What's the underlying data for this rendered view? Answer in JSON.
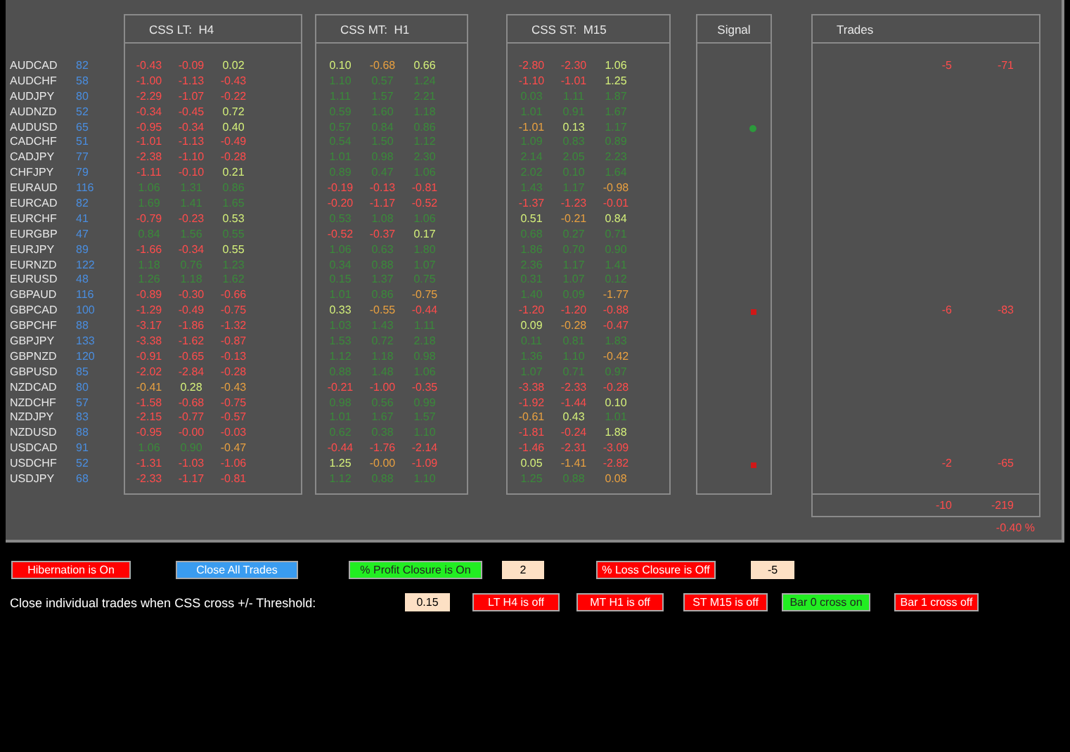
{
  "columns": [
    {
      "title": "CSS LT:  H4"
    },
    {
      "title": "CSS MT:  H1"
    },
    {
      "title": "CSS ST:  M15"
    }
  ],
  "signal_title": "Signal",
  "trades_title": "Trades",
  "rows": [
    {
      "pair": "AUDCAD",
      "count": "82",
      "lt": [
        {
          "text": "-0.43",
          "color": "#ff4c4c"
        },
        {
          "text": "-0.09",
          "color": "#ff4c4c"
        },
        {
          "text": "0.02",
          "color": "#d4f07a"
        }
      ],
      "mt": [
        {
          "text": "0.10",
          "color": "#d4f07a"
        },
        {
          "text": "-0.68",
          "color": "#e8a040"
        },
        {
          "text": "0.66",
          "color": "#d4f07a"
        }
      ],
      "st": [
        {
          "text": "-2.80",
          "color": "#ff4c4c"
        },
        {
          "text": "-2.30",
          "color": "#ff4c4c"
        },
        {
          "text": "1.06",
          "color": "#d4f07a"
        }
      ],
      "trades": [
        "-5",
        "-71"
      ]
    },
    {
      "pair": "AUDCHF",
      "count": "58",
      "lt": [
        {
          "text": "-1.00",
          "color": "#ff4c4c"
        },
        {
          "text": "-1.13",
          "color": "#ff4c4c"
        },
        {
          "text": "-0.43",
          "color": "#ff4c4c"
        }
      ],
      "mt": [
        {
          "text": "1.10",
          "color": "#3a8a3a"
        },
        {
          "text": "0.57",
          "color": "#3a8a3a"
        },
        {
          "text": "1.24",
          "color": "#3a8a3a"
        }
      ],
      "st": [
        {
          "text": "-1.10",
          "color": "#ff4c4c"
        },
        {
          "text": "-1.01",
          "color": "#ff4c4c"
        },
        {
          "text": "1.25",
          "color": "#d4f07a"
        }
      ]
    },
    {
      "pair": "AUDJPY",
      "count": "80",
      "lt": [
        {
          "text": "-2.29",
          "color": "#ff4c4c"
        },
        {
          "text": "-1.07",
          "color": "#ff4c4c"
        },
        {
          "text": "-0.22",
          "color": "#ff4c4c"
        }
      ],
      "mt": [
        {
          "text": "1.11",
          "color": "#3a8a3a"
        },
        {
          "text": "1.57",
          "color": "#3a8a3a"
        },
        {
          "text": "2.21",
          "color": "#3a8a3a"
        }
      ],
      "st": [
        {
          "text": "0.03",
          "color": "#3a8a3a"
        },
        {
          "text": "1.11",
          "color": "#3a8a3a"
        },
        {
          "text": "1.87",
          "color": "#3a8a3a"
        }
      ]
    },
    {
      "pair": "AUDNZD",
      "count": "52",
      "lt": [
        {
          "text": "-0.34",
          "color": "#ff4c4c"
        },
        {
          "text": "-0.45",
          "color": "#ff4c4c"
        },
        {
          "text": "0.72",
          "color": "#d4f07a"
        }
      ],
      "mt": [
        {
          "text": "0.59",
          "color": "#3a8a3a"
        },
        {
          "text": "1.60",
          "color": "#3a8a3a"
        },
        {
          "text": "1.18",
          "color": "#3a8a3a"
        }
      ],
      "st": [
        {
          "text": "1.01",
          "color": "#3a8a3a"
        },
        {
          "text": "0.91",
          "color": "#3a8a3a"
        },
        {
          "text": "1.67",
          "color": "#3a8a3a"
        }
      ]
    },
    {
      "pair": "AUDUSD",
      "count": "65",
      "lt": [
        {
          "text": "-0.95",
          "color": "#ff4c4c"
        },
        {
          "text": "-0.34",
          "color": "#ff4c4c"
        },
        {
          "text": "0.40",
          "color": "#d4f07a"
        }
      ],
      "mt": [
        {
          "text": "0.57",
          "color": "#3a8a3a"
        },
        {
          "text": "0.84",
          "color": "#3a8a3a"
        },
        {
          "text": "0.86",
          "color": "#3a8a3a"
        }
      ],
      "st": [
        {
          "text": "-1.01",
          "color": "#e8a040"
        },
        {
          "text": "0.13",
          "color": "#d4f07a"
        },
        {
          "text": "1.17",
          "color": "#3a8a3a"
        }
      ],
      "signal": {
        "kind": "dot",
        "color": "#2c9a3c"
      }
    },
    {
      "pair": "CADCHF",
      "count": "51",
      "lt": [
        {
          "text": "-1.01",
          "color": "#ff4c4c"
        },
        {
          "text": "-1.13",
          "color": "#ff4c4c"
        },
        {
          "text": "-0.49",
          "color": "#ff4c4c"
        }
      ],
      "mt": [
        {
          "text": "0.54",
          "color": "#3a8a3a"
        },
        {
          "text": "1.50",
          "color": "#3a8a3a"
        },
        {
          "text": "1.12",
          "color": "#3a8a3a"
        }
      ],
      "st": [
        {
          "text": "1.09",
          "color": "#3a8a3a"
        },
        {
          "text": "0.83",
          "color": "#3a8a3a"
        },
        {
          "text": "0.89",
          "color": "#3a8a3a"
        }
      ]
    },
    {
      "pair": "CADJPY",
      "count": "77",
      "lt": [
        {
          "text": "-2.38",
          "color": "#ff4c4c"
        },
        {
          "text": "-1.10",
          "color": "#ff4c4c"
        },
        {
          "text": "-0.28",
          "color": "#ff4c4c"
        }
      ],
      "mt": [
        {
          "text": "1.01",
          "color": "#3a8a3a"
        },
        {
          "text": "0.98",
          "color": "#3a8a3a"
        },
        {
          "text": "2.30",
          "color": "#3a8a3a"
        }
      ],
      "st": [
        {
          "text": "2.14",
          "color": "#3a8a3a"
        },
        {
          "text": "2.05",
          "color": "#3a8a3a"
        },
        {
          "text": "2.23",
          "color": "#3a8a3a"
        }
      ]
    },
    {
      "pair": "CHFJPY",
      "count": "79",
      "lt": [
        {
          "text": "-1.11",
          "color": "#ff4c4c"
        },
        {
          "text": "-0.10",
          "color": "#ff4c4c"
        },
        {
          "text": "0.21",
          "color": "#d4f07a"
        }
      ],
      "mt": [
        {
          "text": "0.89",
          "color": "#3a8a3a"
        },
        {
          "text": "0.47",
          "color": "#3a8a3a"
        },
        {
          "text": "1.06",
          "color": "#3a8a3a"
        }
      ],
      "st": [
        {
          "text": "2.02",
          "color": "#3a8a3a"
        },
        {
          "text": "0.10",
          "color": "#3a8a3a"
        },
        {
          "text": "1.64",
          "color": "#3a8a3a"
        }
      ]
    },
    {
      "pair": "EURAUD",
      "count": "116",
      "lt": [
        {
          "text": "1.06",
          "color": "#3a8a3a"
        },
        {
          "text": "1.31",
          "color": "#3a8a3a"
        },
        {
          "text": "0.86",
          "color": "#3a8a3a"
        }
      ],
      "mt": [
        {
          "text": "-0.19",
          "color": "#ff4c4c"
        },
        {
          "text": "-0.13",
          "color": "#ff4c4c"
        },
        {
          "text": "-0.81",
          "color": "#ff4c4c"
        }
      ],
      "st": [
        {
          "text": "1.43",
          "color": "#3a8a3a"
        },
        {
          "text": "1.17",
          "color": "#3a8a3a"
        },
        {
          "text": "-0.98",
          "color": "#e8a040"
        }
      ]
    },
    {
      "pair": "EURCAD",
      "count": "82",
      "lt": [
        {
          "text": "1.69",
          "color": "#3a8a3a"
        },
        {
          "text": "1.41",
          "color": "#3a8a3a"
        },
        {
          "text": "1.65",
          "color": "#3a8a3a"
        }
      ],
      "mt": [
        {
          "text": "-0.20",
          "color": "#ff4c4c"
        },
        {
          "text": "-1.17",
          "color": "#ff4c4c"
        },
        {
          "text": "-0.52",
          "color": "#ff4c4c"
        }
      ],
      "st": [
        {
          "text": "-1.37",
          "color": "#ff4c4c"
        },
        {
          "text": "-1.23",
          "color": "#ff4c4c"
        },
        {
          "text": "-0.01",
          "color": "#ff4c4c"
        }
      ]
    },
    {
      "pair": "EURCHF",
      "count": "41",
      "lt": [
        {
          "text": "-0.79",
          "color": "#ff4c4c"
        },
        {
          "text": "-0.23",
          "color": "#ff4c4c"
        },
        {
          "text": "0.53",
          "color": "#d4f07a"
        }
      ],
      "mt": [
        {
          "text": "0.53",
          "color": "#3a8a3a"
        },
        {
          "text": "1.08",
          "color": "#3a8a3a"
        },
        {
          "text": "1.06",
          "color": "#3a8a3a"
        }
      ],
      "st": [
        {
          "text": "0.51",
          "color": "#d4f07a"
        },
        {
          "text": "-0.21",
          "color": "#e8a040"
        },
        {
          "text": "0.84",
          "color": "#d4f07a"
        }
      ]
    },
    {
      "pair": "EURGBP",
      "count": "47",
      "lt": [
        {
          "text": "0.84",
          "color": "#3a8a3a"
        },
        {
          "text": "1.56",
          "color": "#3a8a3a"
        },
        {
          "text": "0.55",
          "color": "#3a8a3a"
        }
      ],
      "mt": [
        {
          "text": "-0.52",
          "color": "#ff4c4c"
        },
        {
          "text": "-0.37",
          "color": "#ff4c4c"
        },
        {
          "text": "0.17",
          "color": "#d4f07a"
        }
      ],
      "st": [
        {
          "text": "0.68",
          "color": "#3a8a3a"
        },
        {
          "text": "0.27",
          "color": "#3a8a3a"
        },
        {
          "text": "0.71",
          "color": "#3a8a3a"
        }
      ]
    },
    {
      "pair": "EURJPY",
      "count": "89",
      "lt": [
        {
          "text": "-1.66",
          "color": "#ff4c4c"
        },
        {
          "text": "-0.34",
          "color": "#ff4c4c"
        },
        {
          "text": "0.55",
          "color": "#d4f07a"
        }
      ],
      "mt": [
        {
          "text": "1.06",
          "color": "#3a8a3a"
        },
        {
          "text": "0.63",
          "color": "#3a8a3a"
        },
        {
          "text": "1.80",
          "color": "#3a8a3a"
        }
      ],
      "st": [
        {
          "text": "1.86",
          "color": "#3a8a3a"
        },
        {
          "text": "0.70",
          "color": "#3a8a3a"
        },
        {
          "text": "0.90",
          "color": "#3a8a3a"
        }
      ]
    },
    {
      "pair": "EURNZD",
      "count": "122",
      "lt": [
        {
          "text": "1.18",
          "color": "#3a8a3a"
        },
        {
          "text": "0.76",
          "color": "#3a8a3a"
        },
        {
          "text": "1.23",
          "color": "#3a8a3a"
        }
      ],
      "mt": [
        {
          "text": "0.34",
          "color": "#3a8a3a"
        },
        {
          "text": "0.88",
          "color": "#3a8a3a"
        },
        {
          "text": "1.07",
          "color": "#3a8a3a"
        }
      ],
      "st": [
        {
          "text": "2.36",
          "color": "#3a8a3a"
        },
        {
          "text": "1.17",
          "color": "#3a8a3a"
        },
        {
          "text": "1.41",
          "color": "#3a8a3a"
        }
      ]
    },
    {
      "pair": "EURUSD",
      "count": "48",
      "lt": [
        {
          "text": "1.26",
          "color": "#3a8a3a"
        },
        {
          "text": "1.18",
          "color": "#3a8a3a"
        },
        {
          "text": "1.62",
          "color": "#3a8a3a"
        }
      ],
      "mt": [
        {
          "text": "0.15",
          "color": "#3a8a3a"
        },
        {
          "text": "1.37",
          "color": "#3a8a3a"
        },
        {
          "text": "0.75",
          "color": "#3a8a3a"
        }
      ],
      "st": [
        {
          "text": "0.31",
          "color": "#3a8a3a"
        },
        {
          "text": "1.07",
          "color": "#3a8a3a"
        },
        {
          "text": "0.12",
          "color": "#3a8a3a"
        }
      ]
    },
    {
      "pair": "GBPAUD",
      "count": "116",
      "lt": [
        {
          "text": "-0.89",
          "color": "#ff4c4c"
        },
        {
          "text": "-0.30",
          "color": "#ff4c4c"
        },
        {
          "text": "-0.66",
          "color": "#ff4c4c"
        }
      ],
      "mt": [
        {
          "text": "1.01",
          "color": "#3a8a3a"
        },
        {
          "text": "0.86",
          "color": "#3a8a3a"
        },
        {
          "text": "-0.75",
          "color": "#e8a040"
        }
      ],
      "st": [
        {
          "text": "1.40",
          "color": "#3a8a3a"
        },
        {
          "text": "0.09",
          "color": "#3a8a3a"
        },
        {
          "text": "-1.77",
          "color": "#e8a040"
        }
      ]
    },
    {
      "pair": "GBPCAD",
      "count": "100",
      "lt": [
        {
          "text": "-1.29",
          "color": "#ff4c4c"
        },
        {
          "text": "-0.49",
          "color": "#ff4c4c"
        },
        {
          "text": "-0.75",
          "color": "#ff4c4c"
        }
      ],
      "mt": [
        {
          "text": "0.33",
          "color": "#d4f07a"
        },
        {
          "text": "-0.55",
          "color": "#e8a040"
        },
        {
          "text": "-0.44",
          "color": "#ff4c4c"
        }
      ],
      "st": [
        {
          "text": "-1.20",
          "color": "#ff4c4c"
        },
        {
          "text": "-1.20",
          "color": "#ff4c4c"
        },
        {
          "text": "-0.88",
          "color": "#ff4c4c"
        }
      ],
      "signal": {
        "kind": "square",
        "color": "#d01818"
      },
      "trades": [
        "-6",
        "-83"
      ]
    },
    {
      "pair": "GBPCHF",
      "count": "88",
      "lt": [
        {
          "text": "-3.17",
          "color": "#ff4c4c"
        },
        {
          "text": "-1.86",
          "color": "#ff4c4c"
        },
        {
          "text": "-1.32",
          "color": "#ff4c4c"
        }
      ],
      "mt": [
        {
          "text": "1.03",
          "color": "#3a8a3a"
        },
        {
          "text": "1.43",
          "color": "#3a8a3a"
        },
        {
          "text": "1.11",
          "color": "#3a8a3a"
        }
      ],
      "st": [
        {
          "text": "0.09",
          "color": "#d4f07a"
        },
        {
          "text": "-0.28",
          "color": "#e8a040"
        },
        {
          "text": "-0.47",
          "color": "#ff4c4c"
        }
      ]
    },
    {
      "pair": "GBPJPY",
      "count": "133",
      "lt": [
        {
          "text": "-3.38",
          "color": "#ff4c4c"
        },
        {
          "text": "-1.62",
          "color": "#ff4c4c"
        },
        {
          "text": "-0.87",
          "color": "#ff4c4c"
        }
      ],
      "mt": [
        {
          "text": "1.53",
          "color": "#3a8a3a"
        },
        {
          "text": "0.72",
          "color": "#3a8a3a"
        },
        {
          "text": "2.18",
          "color": "#3a8a3a"
        }
      ],
      "st": [
        {
          "text": "0.11",
          "color": "#3a8a3a"
        },
        {
          "text": "0.81",
          "color": "#3a8a3a"
        },
        {
          "text": "1.83",
          "color": "#3a8a3a"
        }
      ]
    },
    {
      "pair": "GBPNZD",
      "count": "120",
      "lt": [
        {
          "text": "-0.91",
          "color": "#ff4c4c"
        },
        {
          "text": "-0.65",
          "color": "#ff4c4c"
        },
        {
          "text": "-0.13",
          "color": "#ff4c4c"
        }
      ],
      "mt": [
        {
          "text": "1.12",
          "color": "#3a8a3a"
        },
        {
          "text": "1.18",
          "color": "#3a8a3a"
        },
        {
          "text": "0.98",
          "color": "#3a8a3a"
        }
      ],
      "st": [
        {
          "text": "1.36",
          "color": "#3a8a3a"
        },
        {
          "text": "1.10",
          "color": "#3a8a3a"
        },
        {
          "text": "-0.42",
          "color": "#e8a040"
        }
      ]
    },
    {
      "pair": "GBPUSD",
      "count": "85",
      "lt": [
        {
          "text": "-2.02",
          "color": "#ff4c4c"
        },
        {
          "text": "-2.84",
          "color": "#ff4c4c"
        },
        {
          "text": "-0.28",
          "color": "#ff4c4c"
        }
      ],
      "mt": [
        {
          "text": "0.88",
          "color": "#3a8a3a"
        },
        {
          "text": "1.48",
          "color": "#3a8a3a"
        },
        {
          "text": "1.06",
          "color": "#3a8a3a"
        }
      ],
      "st": [
        {
          "text": "1.07",
          "color": "#3a8a3a"
        },
        {
          "text": "0.71",
          "color": "#3a8a3a"
        },
        {
          "text": "0.97",
          "color": "#3a8a3a"
        }
      ]
    },
    {
      "pair": "NZDCAD",
      "count": "80",
      "lt": [
        {
          "text": "-0.41",
          "color": "#e8a040"
        },
        {
          "text": "0.28",
          "color": "#d4f07a"
        },
        {
          "text": "-0.43",
          "color": "#e8a040"
        }
      ],
      "mt": [
        {
          "text": "-0.21",
          "color": "#ff4c4c"
        },
        {
          "text": "-1.00",
          "color": "#ff4c4c"
        },
        {
          "text": "-0.35",
          "color": "#ff4c4c"
        }
      ],
      "st": [
        {
          "text": "-3.38",
          "color": "#ff4c4c"
        },
        {
          "text": "-2.33",
          "color": "#ff4c4c"
        },
        {
          "text": "-0.28",
          "color": "#ff4c4c"
        }
      ]
    },
    {
      "pair": "NZDCHF",
      "count": "57",
      "lt": [
        {
          "text": "-1.58",
          "color": "#ff4c4c"
        },
        {
          "text": "-0.68",
          "color": "#ff4c4c"
        },
        {
          "text": "-0.75",
          "color": "#ff4c4c"
        }
      ],
      "mt": [
        {
          "text": "0.98",
          "color": "#3a8a3a"
        },
        {
          "text": "0.56",
          "color": "#3a8a3a"
        },
        {
          "text": "0.99",
          "color": "#3a8a3a"
        }
      ],
      "st": [
        {
          "text": "-1.92",
          "color": "#ff4c4c"
        },
        {
          "text": "-1.44",
          "color": "#ff4c4c"
        },
        {
          "text": "0.10",
          "color": "#d4f07a"
        }
      ]
    },
    {
      "pair": "NZDJPY",
      "count": "83",
      "lt": [
        {
          "text": "-2.15",
          "color": "#ff4c4c"
        },
        {
          "text": "-0.77",
          "color": "#ff4c4c"
        },
        {
          "text": "-0.57",
          "color": "#ff4c4c"
        }
      ],
      "mt": [
        {
          "text": "1.01",
          "color": "#3a8a3a"
        },
        {
          "text": "1.67",
          "color": "#3a8a3a"
        },
        {
          "text": "1.57",
          "color": "#3a8a3a"
        }
      ],
      "st": [
        {
          "text": "-0.61",
          "color": "#e8a040"
        },
        {
          "text": "0.43",
          "color": "#d4f07a"
        },
        {
          "text": "1.01",
          "color": "#3a8a3a"
        }
      ]
    },
    {
      "pair": "NZDUSD",
      "count": "88",
      "lt": [
        {
          "text": "-0.95",
          "color": "#ff4c4c"
        },
        {
          "text": "-0.00",
          "color": "#ff4c4c"
        },
        {
          "text": "-0.03",
          "color": "#ff4c4c"
        }
      ],
      "mt": [
        {
          "text": "0.62",
          "color": "#3a8a3a"
        },
        {
          "text": "0.38",
          "color": "#3a8a3a"
        },
        {
          "text": "1.10",
          "color": "#3a8a3a"
        }
      ],
      "st": [
        {
          "text": "-1.81",
          "color": "#ff4c4c"
        },
        {
          "text": "-0.24",
          "color": "#ff4c4c"
        },
        {
          "text": "1.88",
          "color": "#d4f07a"
        }
      ]
    },
    {
      "pair": "USDCAD",
      "count": "91",
      "lt": [
        {
          "text": "1.06",
          "color": "#3a8a3a"
        },
        {
          "text": "0.90",
          "color": "#3a8a3a"
        },
        {
          "text": "-0.47",
          "color": "#e8a040"
        }
      ],
      "mt": [
        {
          "text": "-0.44",
          "color": "#ff4c4c"
        },
        {
          "text": "-1.76",
          "color": "#ff4c4c"
        },
        {
          "text": "-2.14",
          "color": "#ff4c4c"
        }
      ],
      "st": [
        {
          "text": "-1.46",
          "color": "#ff4c4c"
        },
        {
          "text": "-2.31",
          "color": "#ff4c4c"
        },
        {
          "text": "-3.09",
          "color": "#ff4c4c"
        }
      ]
    },
    {
      "pair": "USDCHF",
      "count": "52",
      "lt": [
        {
          "text": "-1.31",
          "color": "#ff4c4c"
        },
        {
          "text": "-1.03",
          "color": "#ff4c4c"
        },
        {
          "text": "-1.06",
          "color": "#ff4c4c"
        }
      ],
      "mt": [
        {
          "text": "1.25",
          "color": "#d4f07a"
        },
        {
          "text": "-0.00",
          "color": "#e8a040"
        },
        {
          "text": "-1.09",
          "color": "#ff4c4c"
        }
      ],
      "st": [
        {
          "text": "0.05",
          "color": "#d4f07a"
        },
        {
          "text": "-1.41",
          "color": "#e8a040"
        },
        {
          "text": "-2.82",
          "color": "#ff4c4c"
        }
      ],
      "signal": {
        "kind": "square",
        "color": "#d01818"
      },
      "trades": [
        "-2",
        "-65"
      ]
    },
    {
      "pair": "USDJPY",
      "count": "68",
      "lt": [
        {
          "text": "-2.33",
          "color": "#ff4c4c"
        },
        {
          "text": "-1.17",
          "color": "#ff4c4c"
        },
        {
          "text": "-0.81",
          "color": "#ff4c4c"
        }
      ],
      "mt": [
        {
          "text": "1.12",
          "color": "#3a8a3a"
        },
        {
          "text": "0.88",
          "color": "#3a8a3a"
        },
        {
          "text": "1.10",
          "color": "#3a8a3a"
        }
      ],
      "st": [
        {
          "text": "1.25",
          "color": "#3a8a3a"
        },
        {
          "text": "0.88",
          "color": "#3a8a3a"
        },
        {
          "text": "0.08",
          "color": "#e8a040"
        }
      ]
    }
  ],
  "trades_totals": [
    "-10",
    "-219"
  ],
  "trades_percent": "-0.40 %",
  "controls": [
    {
      "items": [
        {
          "kind": "button",
          "label": "Hibernation is On",
          "color": "#ff0000"
        },
        {
          "kind": "button",
          "label": "Close All Trades",
          "color": "#3a9cf0"
        },
        {
          "kind": "button",
          "label": "% Profit Closure is On",
          "color": "#22ee22"
        },
        {
          "kind": "field",
          "value": "2"
        },
        {
          "kind": "button",
          "label": "% Loss Closure is Off",
          "color": "#ff0000"
        },
        {
          "kind": "field",
          "value": "-5"
        }
      ]
    },
    {
      "label": "Close individual trades when CSS cross +/- Threshold:",
      "items": [
        {
          "kind": "field",
          "value": "0.15"
        },
        {
          "kind": "button",
          "label": "LT  H4 is off",
          "color": "#ff0000"
        },
        {
          "kind": "button",
          "label": "MT  H1 is off",
          "color": "#ff0000"
        },
        {
          "kind": "button",
          "label": "ST  M15 is off",
          "color": "#ff0000"
        },
        {
          "kind": "button",
          "label": "Bar 0 cross on",
          "color": "#22ee22"
        },
        {
          "kind": "button",
          "label": "Bar 1 cross off",
          "color": "#ff0000"
        }
      ]
    }
  ]
}
